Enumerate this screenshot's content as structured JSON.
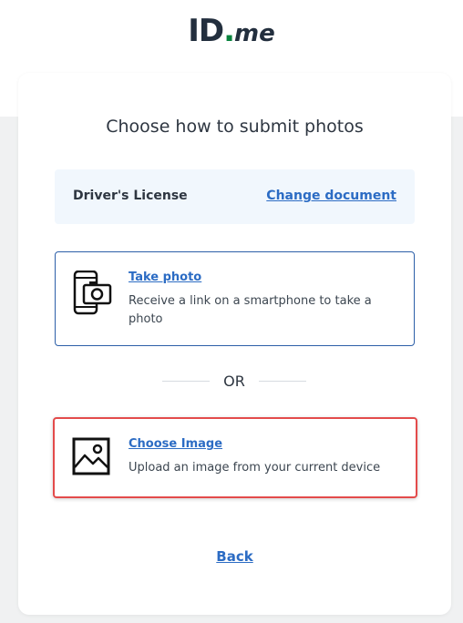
{
  "brand": {
    "logo_id": "ID",
    "logo_dot": ".",
    "logo_me": "me",
    "accent": "#08833d"
  },
  "page": {
    "title": "Choose how to submit photos"
  },
  "document": {
    "type": "Driver's License",
    "change_label": "Change document"
  },
  "options": [
    {
      "title": "Take photo",
      "description": "Receive a link on a smartphone to take a photo",
      "icon": "smartphone-camera-icon"
    },
    {
      "title": "Choose Image",
      "description": "Upload an image from your current device",
      "icon": "image-icon"
    }
  ],
  "divider": {
    "label": "OR"
  },
  "nav": {
    "back_label": "Back"
  },
  "colors": {
    "link": "#2c6cc4",
    "highlight": "#e34b4b"
  }
}
